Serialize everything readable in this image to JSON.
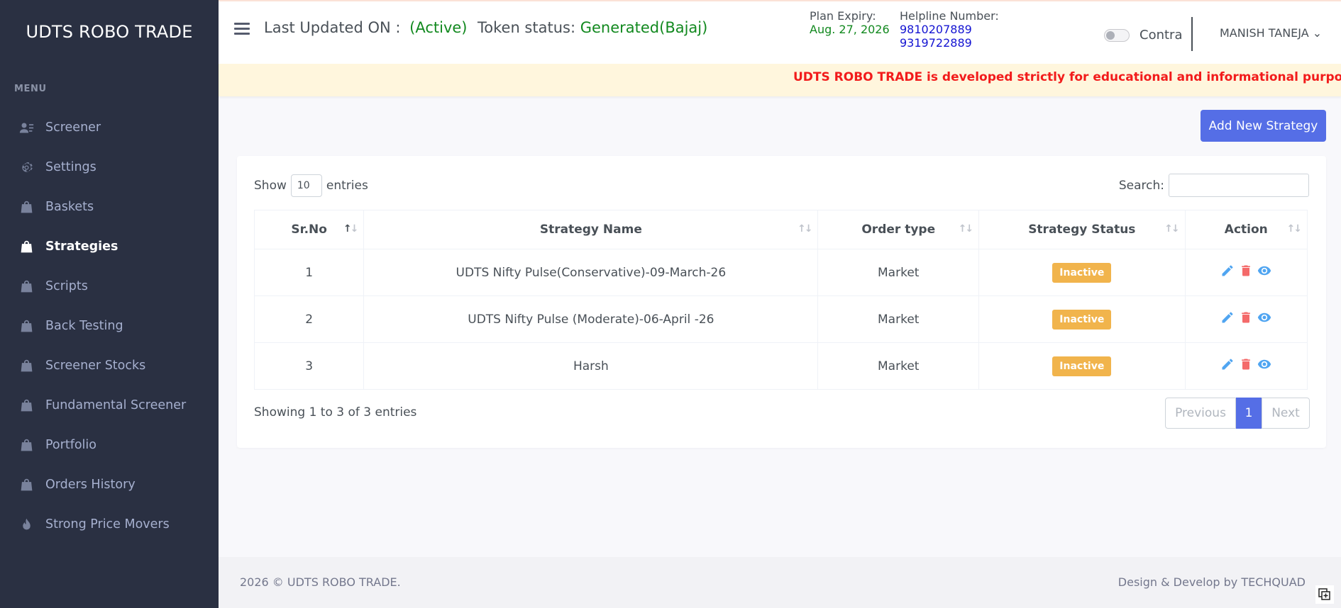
{
  "app": {
    "brand": "UDTS ROBO TRADE"
  },
  "sidebar": {
    "menu_title": "MENU",
    "items": [
      {
        "label": "Screener",
        "icon": "user-list-icon",
        "active": false
      },
      {
        "label": "Settings",
        "icon": "gear-icon",
        "active": false
      },
      {
        "label": "Baskets",
        "icon": "bag-icon",
        "active": false
      },
      {
        "label": "Strategies",
        "icon": "bag-icon",
        "active": true
      },
      {
        "label": "Scripts",
        "icon": "bag-icon",
        "active": false
      },
      {
        "label": "Back Testing",
        "icon": "bag-icon",
        "active": false
      },
      {
        "label": "Screener Stocks",
        "icon": "bag-icon",
        "active": false
      },
      {
        "label": "Fundamental Screener",
        "icon": "bag-icon",
        "active": false
      },
      {
        "label": "Portfolio",
        "icon": "bag-icon",
        "active": false
      },
      {
        "label": "Orders History",
        "icon": "bag-icon",
        "active": false
      },
      {
        "label": "Strong Price Movers",
        "icon": "flame-icon",
        "active": false
      }
    ]
  },
  "header": {
    "last_updated_label": "Last Updated ON :",
    "last_updated_value": "(Active)",
    "token_label": "Token status:",
    "token_value": "Generated(Bajaj)",
    "plan_label": "Plan Expiry:",
    "plan_value": "Aug. 27, 2026",
    "helpline_label": "Helpline Number:",
    "helpline_1": "9810207889",
    "helpline_2": "9319722889",
    "toggle_label": "Contra",
    "toggle_on": false,
    "user_name": "MANISH TANEJA",
    "user_chevron": "⌄"
  },
  "notice": {
    "text": "UDTS ROBO TRADE is developed strictly for educational and informational purposes only. It prov"
  },
  "main": {
    "add_button": "Add New Strategy",
    "show_label": "Show",
    "show_value": "10",
    "entries_label": "entries",
    "search_label": "Search:",
    "search_value": "",
    "columns": [
      "Sr.No",
      "Strategy Name",
      "Order type",
      "Strategy Status",
      "Action"
    ],
    "rows": [
      {
        "sr": "1",
        "name": "UDTS Nifty Pulse(Conservative)-09-March-26",
        "order": "Market",
        "status": "Inactive"
      },
      {
        "sr": "2",
        "name": "UDTS Nifty Pulse (Moderate)-06-April -26",
        "order": "Market",
        "status": "Inactive"
      },
      {
        "sr": "3",
        "name": "Harsh",
        "order": "Market",
        "status": "Inactive"
      }
    ],
    "info": "Showing 1 to 3 of 3 entries",
    "pager": {
      "prev": "Previous",
      "current": "1",
      "next": "Next"
    }
  },
  "footer": {
    "left": "2026 © UDTS ROBO TRADE.",
    "right": "Design & Develop by TECHQUAD"
  },
  "colors": {
    "sidebar": "#2a3042",
    "accent": "#556ee6",
    "green": "#12891f",
    "warning": "#f1b44c",
    "danger": "#f46a6a",
    "info": "#50a5f1"
  }
}
